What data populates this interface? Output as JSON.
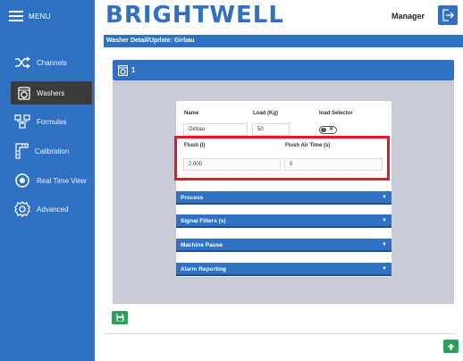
{
  "sidebar": {
    "menu_label": "MENU",
    "items": [
      {
        "label": "Channels",
        "icon": "shuffle-icon"
      },
      {
        "label": "Washers",
        "icon": "washer-icon"
      },
      {
        "label": "Formulas",
        "icon": "formula-icon"
      },
      {
        "label": "Calibration",
        "icon": "calibration-icon"
      },
      {
        "label": "Real Time View",
        "icon": "eye-icon"
      },
      {
        "label": "Advanced",
        "icon": "gear-icon"
      }
    ],
    "active_item": "Washers"
  },
  "header": {
    "brand": "BRIGHTWELL",
    "user": "Manager"
  },
  "breadcrumb": "Washer Detail/Update: Girbau",
  "panel": {
    "washer_number": "1"
  },
  "form": {
    "name_label": "Name",
    "name_value": "Girbau",
    "load_label": "Load (Kg)",
    "load_value": "50",
    "selector_label": "load Selector",
    "flush_label": "Flush (l)",
    "flush_value": "2.000",
    "flush_air_label": "Flush Air Time (s)",
    "flush_air_value": "0"
  },
  "accordions": [
    "Process",
    "Signal Filters (s)",
    "Machine Pause",
    "Alarm Reporting"
  ],
  "colors": {
    "primary": "#2f72c4",
    "highlight": "#e01b24",
    "success": "#2e9e5b"
  }
}
